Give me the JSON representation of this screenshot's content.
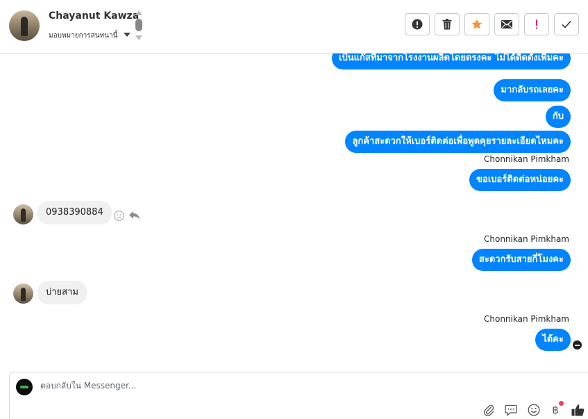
{
  "header": {
    "contact_name": "Chayanut Kawza",
    "assign_label": "มอบหมายการสนทนานี้",
    "toolbar": [
      {
        "name": "spam-button",
        "icon": "alert-circle-icon"
      },
      {
        "name": "delete-button",
        "icon": "trash-icon"
      },
      {
        "name": "star-button",
        "icon": "star-icon",
        "color": "#f7923a"
      },
      {
        "name": "mark-unread-button",
        "icon": "envelope-icon"
      },
      {
        "name": "follow-up-button",
        "icon": "exclamation-icon",
        "color": "#e0245e"
      },
      {
        "name": "done-button",
        "icon": "check-icon"
      }
    ]
  },
  "messages": {
    "m1": "เป็นแก๊สที่มาจากโรงงานผลิตโดยตรงคะ ไม่ได้ติดตั้งเพิ่มคะ",
    "m2": "มากลับรถเลยคะ",
    "m3": "กับ",
    "m4": "ลูกค้าสะดวกให้เบอร์ติดต่อเพื่อพูดคุยรายละเอียดไหมคะ",
    "m5_sender": "Chonnikan Pimkham",
    "m5": "ขอเบอร์ติดต่อหน่อยคะ",
    "m6": "0938390884",
    "m7_sender": "Chonnikan Pimkham",
    "m7": "สะดวกรับสายกี่โมงคะ",
    "m8": "บ่ายสาม",
    "m9_sender": "Chonnikan Pimkham",
    "m9": "ได้คะ"
  },
  "composer": {
    "placeholder": "ตอบกลับใน Messenger...",
    "tools": [
      "paperclip-icon",
      "saved-reply-icon",
      "emoji-icon",
      "baht-payment-icon",
      "thumbs-up-icon"
    ],
    "baht_symbol": "฿",
    "accent": "#0084ff"
  }
}
